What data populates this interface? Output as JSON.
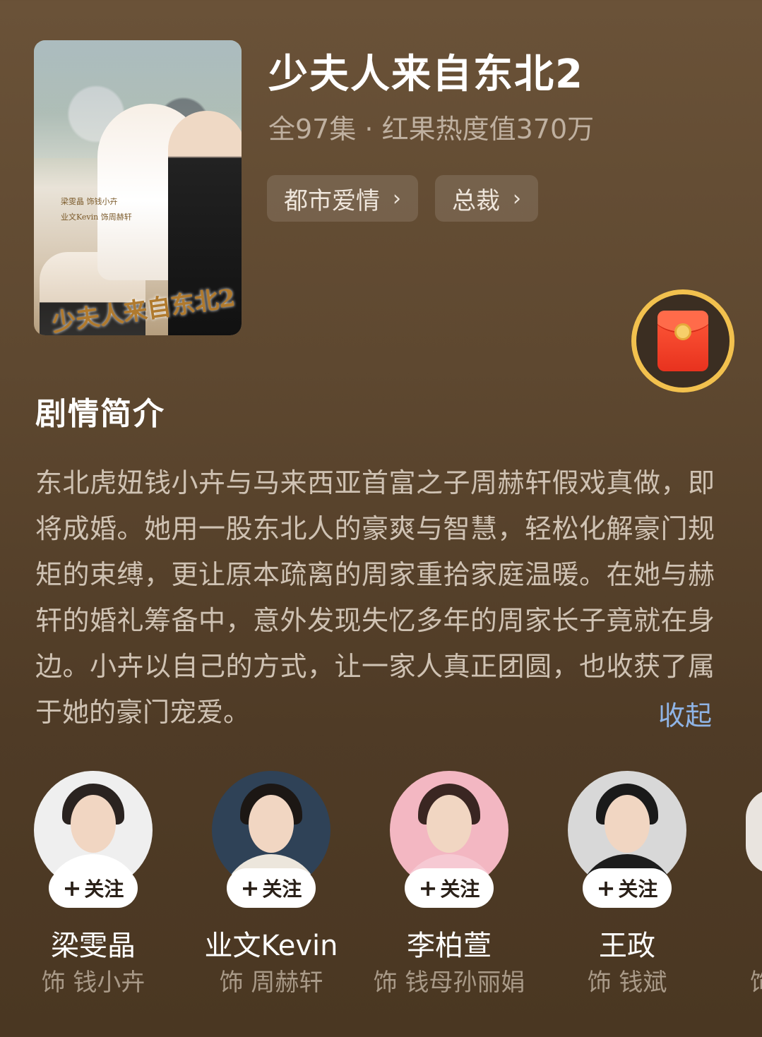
{
  "show": {
    "title": "少夫人来自东北2",
    "meta": "全97集 · 红果热度值370万",
    "tags": [
      {
        "label": "都市爱情"
      },
      {
        "label": "总裁"
      }
    ],
    "poster": {
      "title_art": "少夫人来自东北2",
      "cast_line_1": "梁雯晶 饰钱小卉",
      "cast_line_2": "业文Kevin 饰周赫轩"
    }
  },
  "synopsis": {
    "heading": "剧情简介",
    "text": "东北虎妞钱小卉与马来西亚首富之子周赫轩假戏真做，即将成婚。她用一股东北人的豪爽与智慧，轻松化解豪门规矩的束缚，更让原本疏离的周家重拾家庭温暖。在她与赫轩的婚礼筹备中，意外发现失忆多年的周家长子竟就在身边。小卉以自己的方式，让一家人真正团圆，也收获了属于她的豪门宠爱。",
    "collapse_label": "收起"
  },
  "cast": [
    {
      "name": "梁雯晶",
      "role": "饰 钱小卉",
      "follow": "关注",
      "bg": "#efefef",
      "outfit": "#ffffff",
      "hair": "#2a2320"
    },
    {
      "name": "业文Kevin",
      "role": "饰 周赫轩",
      "follow": "关注",
      "bg": "#2f4257",
      "outfit": "#ece6dc",
      "hair": "#1c1714"
    },
    {
      "name": "李柏萱",
      "role": "饰 钱母孙丽娟",
      "follow": "关注",
      "bg": "#f3b7c2",
      "outfit": "#f6c9d3",
      "hair": "#3a2622"
    },
    {
      "name": "王政",
      "role": "饰 钱斌",
      "follow": "关注",
      "bg": "#d8d8d8",
      "outfit": "#1d1d1d",
      "hair": "#1a1a1a"
    }
  ],
  "cast_partial_role": "饰",
  "colors": {
    "accent_link": "#8fb4e6",
    "envelope_ring": "#f2c14e",
    "envelope_red": "#e8321e"
  }
}
